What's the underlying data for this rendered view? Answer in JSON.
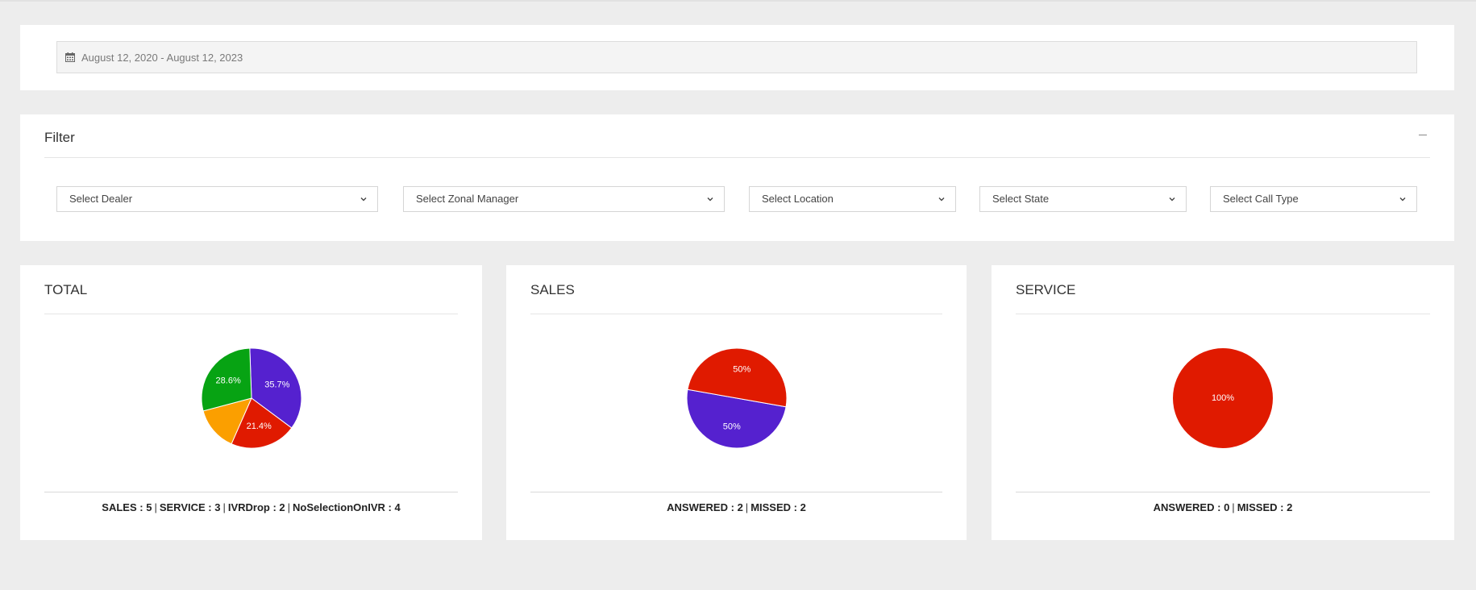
{
  "date_range": {
    "value": "August 12, 2020 - August 12, 2023",
    "icon": "calendar-icon"
  },
  "filter": {
    "title": "Filter",
    "collapse_icon": "minus-icon",
    "selects": [
      {
        "label": "Select Dealer"
      },
      {
        "label": "Select Zonal Manager"
      },
      {
        "label": "Select Location"
      },
      {
        "label": "Select State"
      },
      {
        "label": "Select Call Type"
      }
    ]
  },
  "panels": {
    "total": {
      "title": "TOTAL",
      "summary": [
        {
          "label": "SALES",
          "value": "5"
        },
        {
          "label": "SERVICE",
          "value": "3"
        },
        {
          "label": "IVRDrop",
          "value": "2"
        },
        {
          "label": "NoSelectionOnIVR",
          "value": "4"
        }
      ]
    },
    "sales": {
      "title": "SALES",
      "summary": [
        {
          "label": "ANSWERED",
          "value": "2"
        },
        {
          "label": "MISSED",
          "value": "2"
        }
      ]
    },
    "service": {
      "title": "SERVICE",
      "summary": [
        {
          "label": "ANSWERED",
          "value": "0"
        },
        {
          "label": "MISSED",
          "value": "2"
        }
      ]
    }
  },
  "chart_data": [
    {
      "type": "pie",
      "panel": "total",
      "slices": [
        {
          "category": "SALES",
          "value": 5,
          "label": "35.7%",
          "color": "#5521cf"
        },
        {
          "category": "SERVICE",
          "value": 3,
          "label": "21.4%",
          "color": "#e01a00"
        },
        {
          "category": "IVRDrop",
          "value": 2,
          "label": "",
          "color": "#fb9f00"
        },
        {
          "category": "NoSelectionOnIVR",
          "value": 4,
          "label": "28.6%",
          "color": "#07a313"
        }
      ]
    },
    {
      "type": "pie",
      "panel": "sales",
      "slices": [
        {
          "category": "ANSWERED",
          "value": 2,
          "label": "50%",
          "color": "#5521cf"
        },
        {
          "category": "MISSED",
          "value": 2,
          "label": "50%",
          "color": "#e01a00"
        }
      ]
    },
    {
      "type": "pie",
      "panel": "service",
      "slices": [
        {
          "category": "ANSWERED",
          "value": 0,
          "label": "",
          "color": "#5521cf"
        },
        {
          "category": "MISSED",
          "value": 2,
          "label": "100%",
          "color": "#e01a00"
        }
      ]
    }
  ]
}
